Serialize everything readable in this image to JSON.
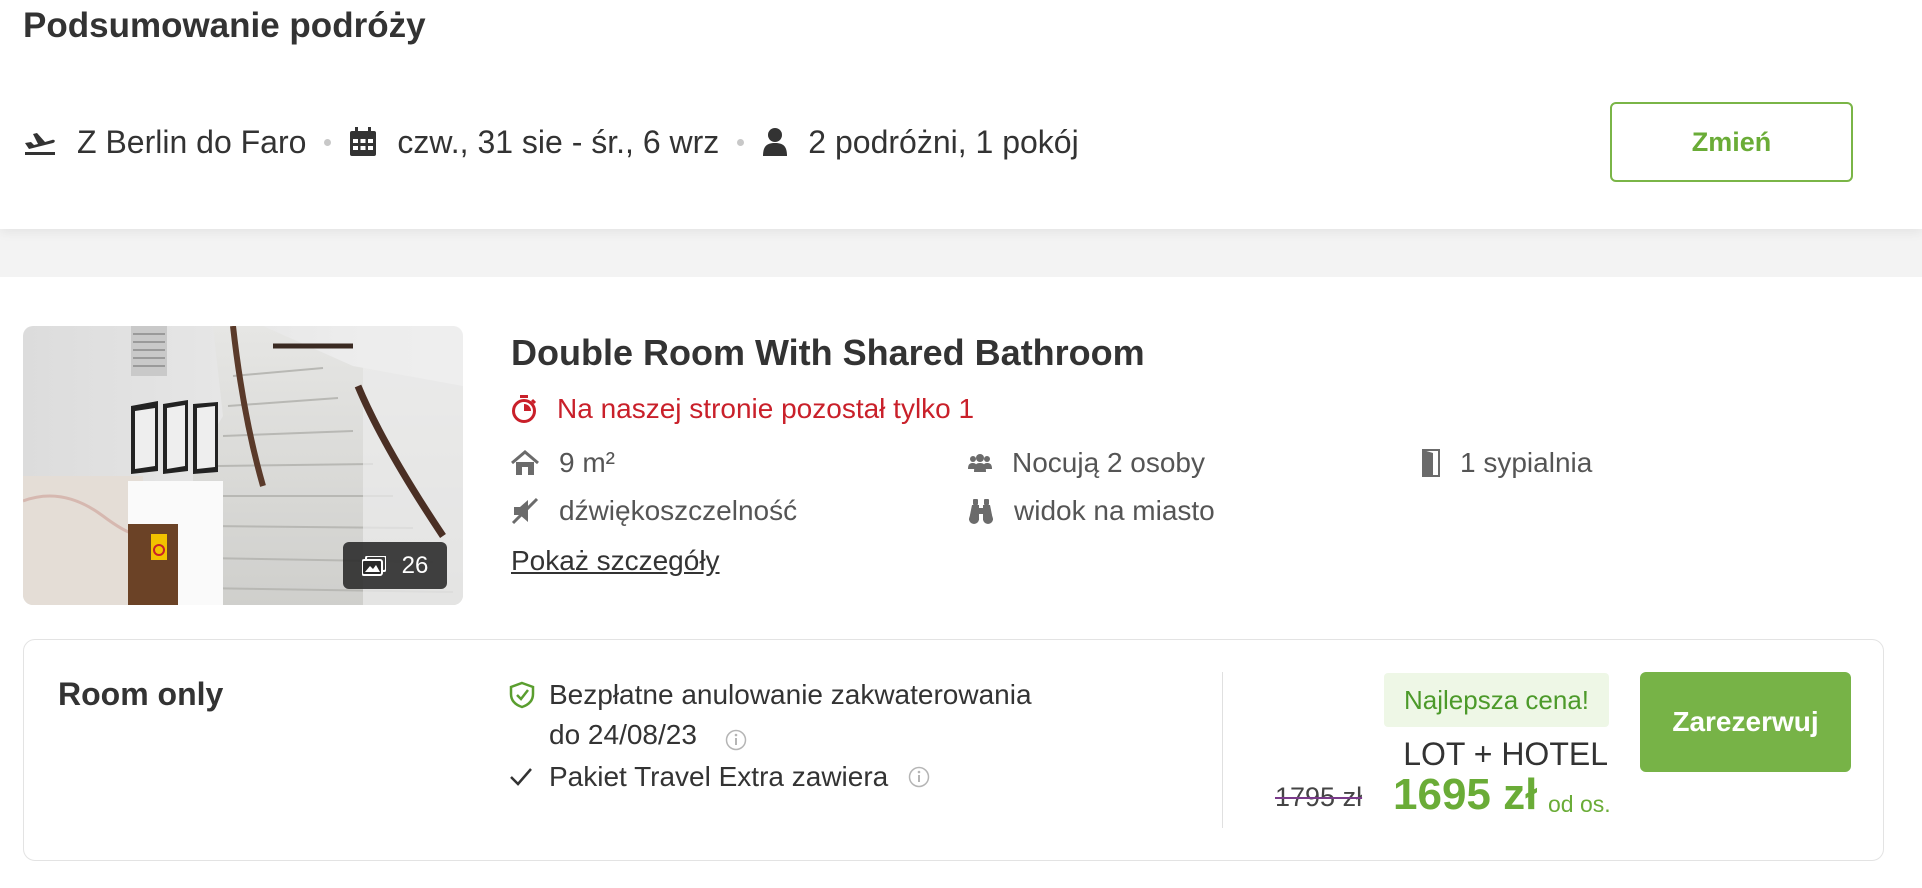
{
  "summary": {
    "title": "Podsumowanie podróży",
    "route": "Z Berlin do Faro",
    "dates": "czw., 31 sie - śr., 6 wrz",
    "travelers": "2 podróżni, 1 pokój",
    "change_label": "Zmień"
  },
  "room": {
    "title": "Double Room With Shared Bathroom",
    "availability": "Na naszej stronie pozostał tylko 1",
    "photo_count": "26",
    "features": {
      "size": "9 m²",
      "occupancy": "Nocują 2 osoby",
      "bedrooms": "1 sypialnia",
      "soundproof": "dźwiękoszczelność",
      "view": "widok na miasto"
    },
    "details_link": "Pokaż szczegóły"
  },
  "rate": {
    "board": "Room only",
    "cancellation_line1": "Bezpłatne anulowanie zakwaterowania",
    "cancellation_line2": "do 24/08/23",
    "travel_extra": "Pakiet Travel Extra zawiera",
    "best_price_badge": "Najlepsza cena!",
    "package": "LOT + HOTEL",
    "old_price": "1795 zł",
    "new_price": "1695 zł",
    "per_person": "od os.",
    "book_label": "Zarezerwuj"
  },
  "colors": {
    "accent_green": "#77b347",
    "alert_red": "#c9202a"
  }
}
